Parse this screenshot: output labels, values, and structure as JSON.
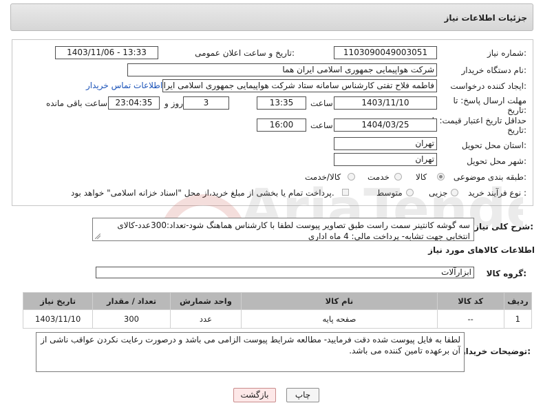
{
  "header": {
    "title": "جزئیات اطلاعات نیاز"
  },
  "form": {
    "need_number_label": "شماره نیاز:",
    "need_number": "1103090049003051",
    "announce_label": "تاریخ و ساعت اعلان عمومی:",
    "announce_value": "1403/11/06 - 13:33",
    "buyer_label": "نام دستگاه خریدار:",
    "buyer_value": "شرکت هواپیمایی جمهوری اسلامی ایران هما",
    "creator_label": "ایجاد کننده درخواست:",
    "creator_value": "فاطمه فلاح تفتی کارشناس سامانه ستاد شرکت هواپیمایی جمهوری اسلامی ایران هما",
    "contact_link": "اطلاعات تماس خریدار",
    "deadline_label_1": "مهلت ارسال پاسخ: تا",
    "deadline_label_2": "تاریخ:",
    "deadline_date": "1403/11/10",
    "time_word": "ساعت",
    "deadline_time": "13:35",
    "days_value": "3",
    "days_word": "روز و",
    "remaining_value": "23:04:35",
    "remaining_word": "ساعت باقی مانده",
    "validity_label_1": "حداقل تاریخ اعتبار قیمت: تا",
    "validity_label_2": "تاریخ:",
    "validity_date": "1404/03/25",
    "validity_time": "16:00",
    "province_label": "استان محل تحویل:",
    "province_value": "تهران",
    "city_label": "شهر محل تحویل:",
    "city_value": "تهران",
    "category_label": "طبقه بندی موضوعی:",
    "category_options": [
      "کالا",
      "خدمت",
      "کالا/خدمت"
    ],
    "category_selected": "کالا",
    "process_label": "نوع فرآیند خرید :",
    "process_options": [
      "جزیی",
      "متوسط"
    ],
    "process_selected": "",
    "payment_note": "پرداخت تمام یا بخشی از مبلغ خرید،از محل \"اسناد خزانه اسلامی\" خواهد بود."
  },
  "description": {
    "label": "شرح کلی نیاز:",
    "text": "سه گوشه کانتینر سمت راست طبق تصاویر پیوست لطفا با کارشناس هماهنگ شود-تعداد:300عدد-کالای انتخابی جهت تشابه- پرداخت مالی: 4 ماه اداری"
  },
  "goods": {
    "section_title": "اطلاعات کالاهای مورد نیاز",
    "group_label": "گروه کالا:",
    "group_value": "ابزارآلات",
    "columns": [
      "ردیف",
      "کد کالا",
      "نام کالا",
      "واحد شمارش",
      "تعداد / مقدار",
      "تاریخ نیاز"
    ],
    "rows": [
      {
        "row": "1",
        "code": "--",
        "name": "صفحه پایه",
        "unit": "عدد",
        "qty": "300",
        "date": "1403/11/10"
      }
    ]
  },
  "buyer_notes": {
    "label": "توضیحات خریدار:",
    "text": "لطفا به فایل پیوست شده دقت فرمایید- مطالعه شرایط پیوست الزامی می باشد و درصورت رعایت نکردن عواقب ناشی از آن برعهده تامین کننده می باشد."
  },
  "buttons": {
    "print": "چاپ",
    "back": "بازگشت"
  },
  "watermark": {
    "text": "AriaTender.neT"
  }
}
